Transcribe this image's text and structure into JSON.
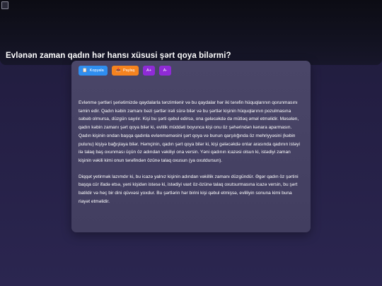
{
  "article": {
    "title": "Evlənən zaman qadın hər hansı xüsusi şərt qoya bilərmi?"
  },
  "toolbar": {
    "copy_label": "Kopyala",
    "share_label": "Paylaş",
    "font_increase_label": "A+",
    "font_decrease_label": "A-",
    "copy_icon": "clipboard-icon",
    "share_icon": "share-icon",
    "colors": {
      "copy": "#2f8ef0",
      "share": "#f5831f",
      "font": "#8f2bd6"
    }
  },
  "content": {
    "paragraphs": [
      "Evlənmə şərtləri şəriətimizdə qaydalarla tənzimlənir və bu qaydalar hər iki tərəfin hüquqlarının qorunmasını təmin edir. Qadın kəbin zamanı bəzi şərtlər irəli sürə bilər və bu şərtlər kişinin hüquqlarının pozulmasına səbəb olmursa, düzgün sayılır. Kişi bu şərti qəbul edirsə, ona gələcəkdə də mütləq əməl etməlidir. Məsələn, qadın kəbin zamanı şərt qoya bilər ki, evlilik müddəti boyunca kişi onu öz şəhərindən kənara aparmasın. Qadın kişinin ondan başqa qadınla evlənməməsini şərt qoya və bunun qarşılığında öz mehriyyəsini (kəbin pulunu) kişiyə bağışlaya bilər. Həmçinin, qadın şərt qoya bilər ki, kişi gələcəkdə onlar arasında qadının istəyi ilə talaq baş oxunması üçün öz adından vəkiliyi ona versin. Yəni qadının icazəsi olsun ki, istədiyi zaman kişinin vəkili kimi onun tərəfindən özünə talaq oxusun (ya oxutdursun).",
      "Diqqət yetirmək lazımdır ki, bu icazə yalnız kişinin adından vəkillik zamanı düzgündür. Əgər qadın öz şərtini başqa cür ifadə etsə, yəni kişidən istəsə ki, istədiyi vaxt öz-özünə talaq oxutsurmasına icazə versin, bu şərt batildir və heç bir dini qüvvəsi yoxdur. Bu şərtlərin hər birini kişi qəbul etmişsə, evliliyin sonuna kimi buna riayət etməlidir."
    ]
  }
}
